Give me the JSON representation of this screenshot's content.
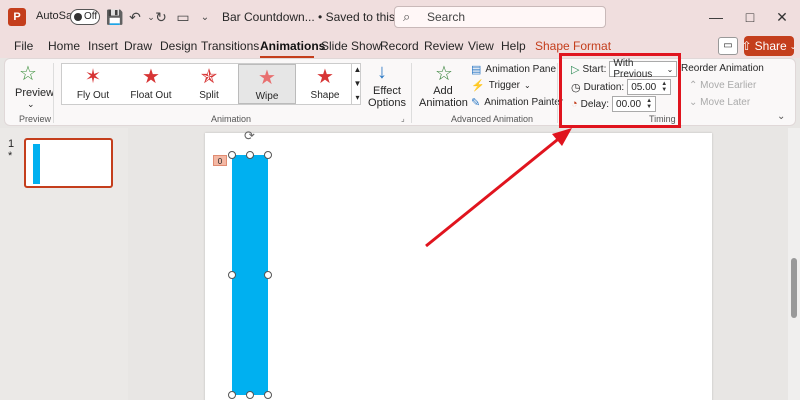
{
  "titlebar": {
    "autosave_label": "AutoSave",
    "autosave_state": "Off",
    "doc_title": "Bar Countdown... • Saved to this PC",
    "search_placeholder": "Search"
  },
  "menu": {
    "items": [
      "File",
      "Home",
      "Insert",
      "Draw",
      "Design",
      "Transitions",
      "Animations",
      "Slide Show",
      "Record",
      "Review",
      "View",
      "Help",
      "Shape Format"
    ],
    "active": "Animations",
    "share_label": "Share"
  },
  "ribbon": {
    "preview_label": "Preview",
    "preview_group": "Preview",
    "animation_group": "Animation",
    "effects": [
      {
        "label": "Fly Out",
        "selected": false
      },
      {
        "label": "Float Out",
        "selected": false
      },
      {
        "label": "Split",
        "selected": false
      },
      {
        "label": "Wipe",
        "selected": true
      },
      {
        "label": "Shape",
        "selected": false
      }
    ],
    "effect_options_label": "Effect Options",
    "add_animation_label": "Add Animation",
    "advanced_group": "Advanced Animation",
    "animation_pane": "Animation Pane",
    "trigger": "Trigger",
    "animation_painter": "Animation Painter",
    "timing_group": "Timing",
    "start_label": "Start:",
    "start_value": "With Previous",
    "duration_label": "Duration:",
    "duration_value": "05.00",
    "delay_label": "Delay:",
    "delay_value": "00.00",
    "reorder_title": "Reorder Animation",
    "move_earlier": "Move Earlier",
    "move_later": "Move Later"
  },
  "slides": {
    "slide_number": "1",
    "slide_star": "*",
    "anim_tag": "0"
  },
  "colors": {
    "accent": "#c43e1c",
    "shape_fill": "#00b0f0",
    "highlight": "#e0141e"
  }
}
